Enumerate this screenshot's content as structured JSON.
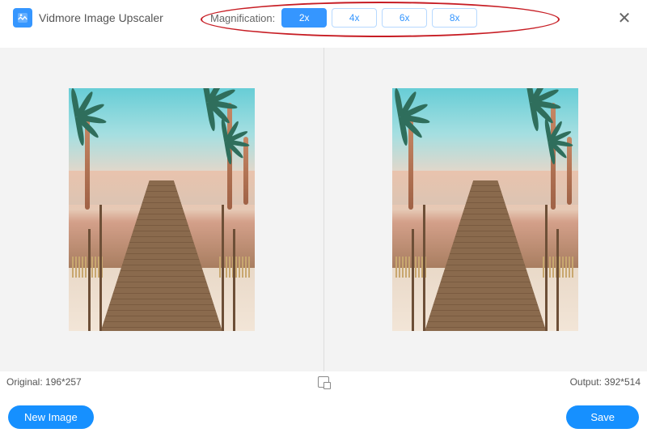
{
  "app": {
    "title": "Vidmore Image Upscaler"
  },
  "magnification": {
    "label": "Magnification:",
    "options": [
      "2x",
      "4x",
      "6x",
      "8x"
    ],
    "selected": "2x"
  },
  "panes": {
    "original_label": "Original: 196*257",
    "output_label": "Output: 392*514"
  },
  "footer": {
    "new_image_label": "New Image",
    "save_label": "Save"
  },
  "icons": {
    "close": "✕"
  }
}
